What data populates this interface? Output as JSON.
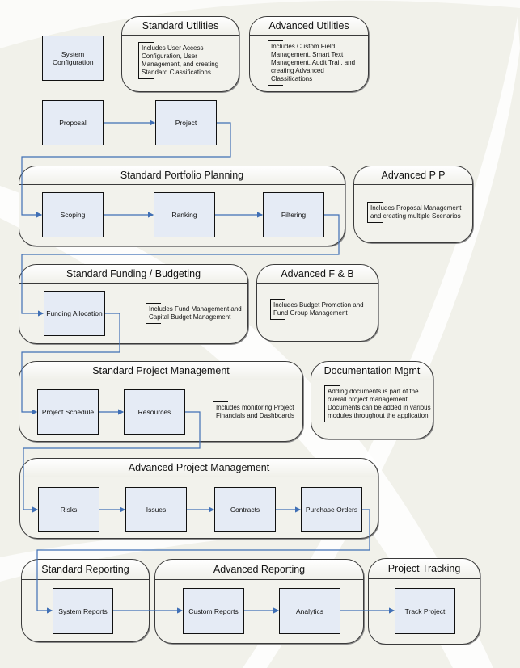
{
  "colors": {
    "background": "#f1f1ea",
    "box_fill": "#e5ebf5",
    "connector": "#3f6fb5",
    "group_border": "#3a3a3a"
  },
  "top": {
    "system_configuration": "System Configuration",
    "proposal": "Proposal",
    "project": "Project"
  },
  "standard_utilities": {
    "title": "Standard Utilities",
    "note": "Includes User Access Configuration, User Management, and creating Standard Classifications"
  },
  "advanced_utilities": {
    "title": "Advanced Utilities",
    "note": "Includes Custom Field Management, Smart Text Management, Audit Trail, and creating Advanced Classifications"
  },
  "standard_portfolio_planning": {
    "title": "Standard Portfolio Planning",
    "steps": [
      "Scoping",
      "Ranking",
      "Filtering"
    ]
  },
  "advanced_pp": {
    "title": "Advanced P P",
    "note": "Includes Proposal Management and creating multiple Scenarios"
  },
  "standard_funding": {
    "title": "Standard Funding / Budgeting",
    "step": "Funding Allocation",
    "note": "Includes Fund Management and Capital Budget Management"
  },
  "advanced_fb": {
    "title": "Advanced F & B",
    "note": "Includes Budget Promotion and Fund Group Management"
  },
  "standard_pm": {
    "title": "Standard Project Management",
    "steps": [
      "Project Schedule",
      "Resources"
    ],
    "note": "Includes monitoring Project Financials and Dashboards"
  },
  "documentation_mgmt": {
    "title": "Documentation Mgmt",
    "note": "Adding documents is part of the overall project management. Documents can be added in various modules throughout the application"
  },
  "advanced_pm": {
    "title": "Advanced Project Management",
    "steps": [
      "Risks",
      "Issues",
      "Contracts",
      "Purchase Orders"
    ]
  },
  "standard_reporting": {
    "title": "Standard Reporting",
    "step": "System Reports"
  },
  "advanced_reporting": {
    "title": "Advanced Reporting",
    "steps": [
      "Custom Reports",
      "Analytics"
    ]
  },
  "project_tracking": {
    "title": "Project Tracking",
    "step": "Track Project"
  }
}
